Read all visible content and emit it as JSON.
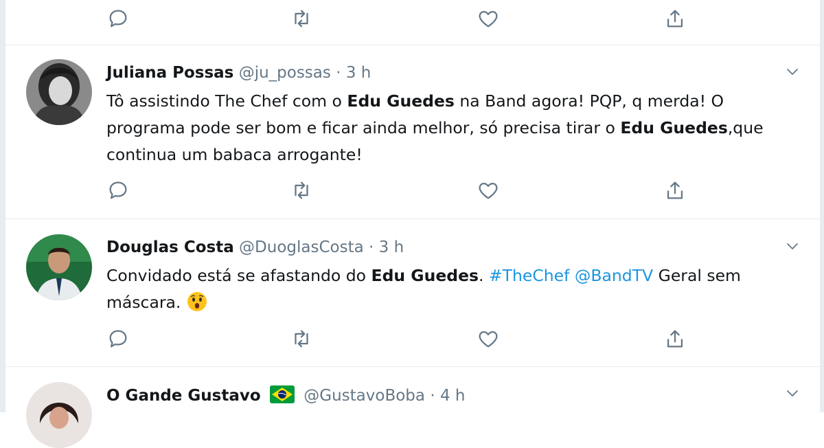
{
  "colors": {
    "text": "#14171a",
    "meta": "#657786",
    "link": "#1b95e0",
    "divider": "#e6ecf0",
    "icon": "#657786"
  },
  "icons": {
    "reply": "reply-icon",
    "retweet": "retweet-icon",
    "like": "heart-icon",
    "share": "share-icon",
    "more": "chevron-down-icon"
  },
  "tweets": [
    {
      "name": "Juliana Possas",
      "handle": "@ju_possas",
      "sep": "·",
      "time": "3 h",
      "text": {
        "p1": "Tô assistindo The Chef com o ",
        "b1": "Edu Guedes",
        "p2": " na Band agora! PQP, q merda! O programa pode ser bom e ficar ainda melhor, só precisa tirar o ",
        "b2": "Edu Guedes",
        "p3": ",que continua um babaca arrogante!"
      }
    },
    {
      "name": "Douglas Costa",
      "handle": "@DuoglasCosta",
      "sep": "·",
      "time": "3 h",
      "text": {
        "p1": "Convidado está se afastando do ",
        "b1": "Edu Guedes",
        "p2": ". ",
        "hashtag": "#TheChef",
        "p3": " ",
        "mention": "@BandTV",
        "p4": " Geral sem máscara. ",
        "emoji": "😲"
      }
    },
    {
      "name": "O Gande Gustavo",
      "flag": "🇧🇷",
      "handle": "@GustavoBoba",
      "sep": "·",
      "time": "4 h"
    }
  ]
}
